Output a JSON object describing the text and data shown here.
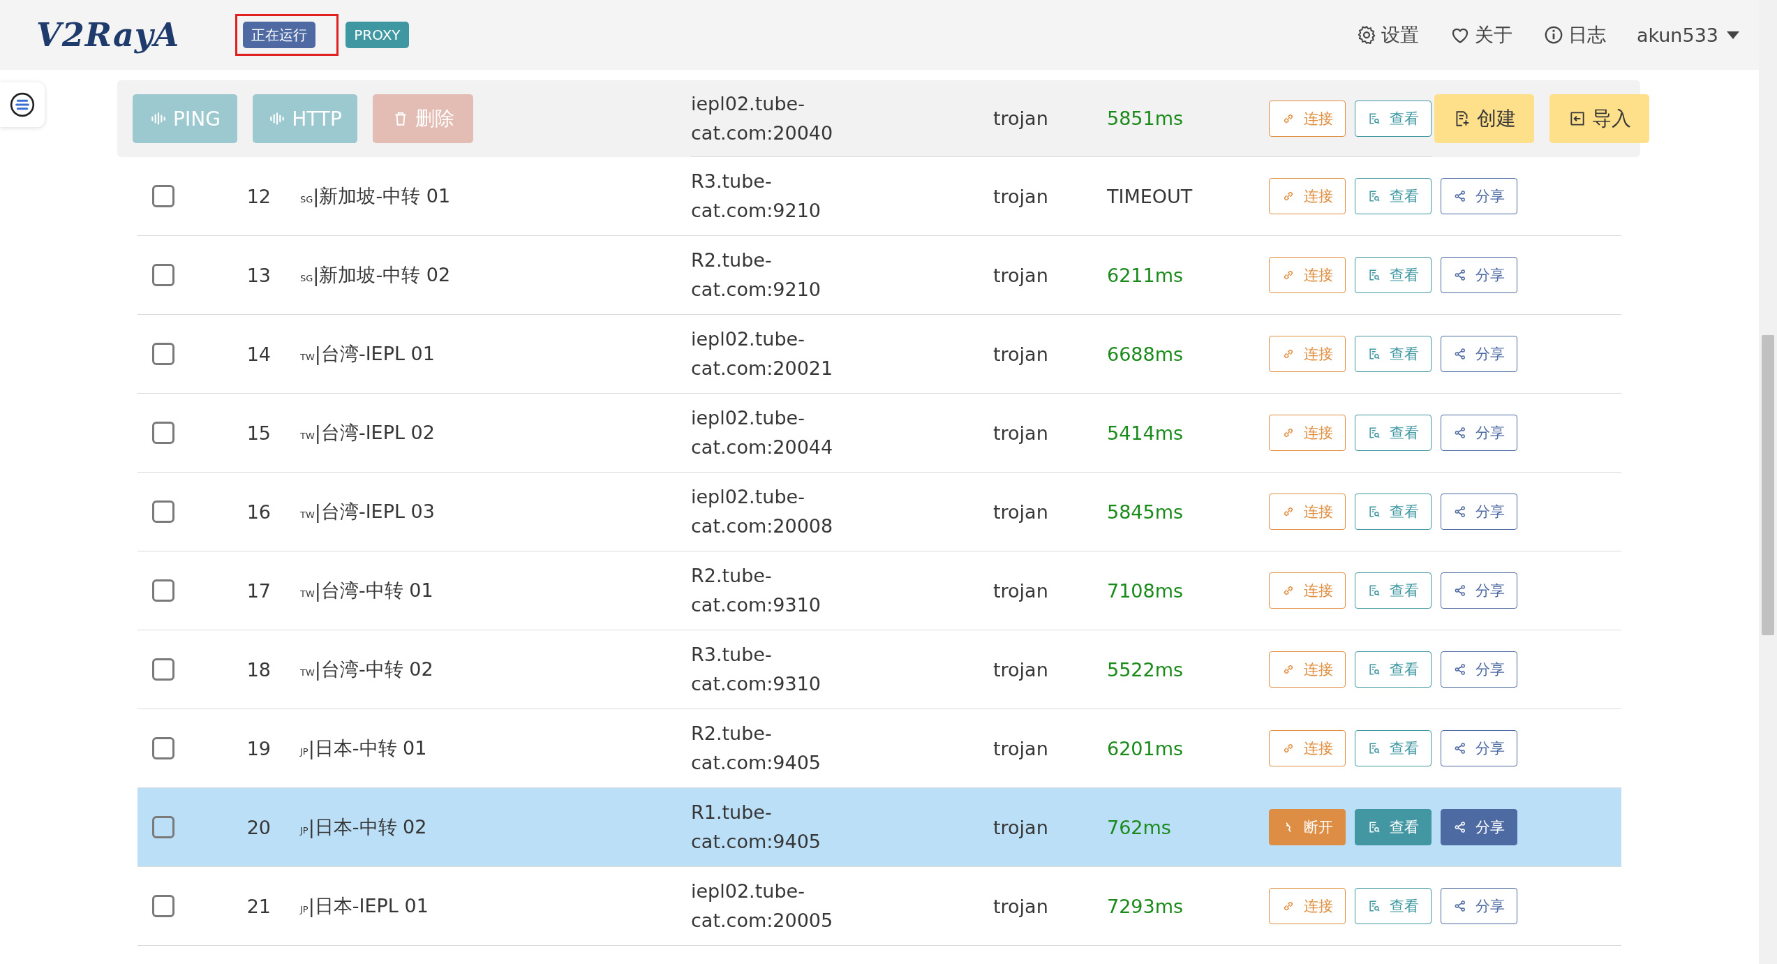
{
  "header": {
    "logo": "V2RayA",
    "status_badge": "正在运行",
    "status_highlighted": true,
    "mode_badge": "PROXY",
    "nav": [
      {
        "kind": "settings",
        "label": "设置"
      },
      {
        "kind": "about",
        "label": "关于"
      },
      {
        "kind": "log",
        "label": "日志"
      },
      {
        "kind": "user",
        "label": "akun533"
      }
    ]
  },
  "toolbar": {
    "left": [
      {
        "kind": "ping",
        "label": "PING"
      },
      {
        "kind": "http",
        "label": "HTTP"
      },
      {
        "kind": "delete",
        "label": "删除"
      }
    ],
    "right": [
      {
        "kind": "create",
        "label": "创建"
      },
      {
        "kind": "import",
        "label": "导入"
      }
    ]
  },
  "rows": [
    {
      "selected": false,
      "address": [
        "iepl02.tube-",
        "cat.com:20040"
      ],
      "protocol": "trojan",
      "latency": "5851ms",
      "timed_out": false,
      "actions": [
        {
          "kind": "connect",
          "label": "连接"
        },
        {
          "kind": "view",
          "label": "查看"
        }
      ]
    },
    {
      "checked": false,
      "selected": false,
      "number": "12",
      "region": "sg",
      "name": "|新加坡-中转 01",
      "address": [
        "R3.tube-",
        "cat.com:9210"
      ],
      "protocol": "trojan",
      "latency": "TIMEOUT",
      "timed_out": true,
      "actions": [
        {
          "kind": "connect",
          "label": "连接"
        },
        {
          "kind": "view",
          "label": "查看"
        },
        {
          "kind": "share",
          "label": "分享"
        }
      ]
    },
    {
      "checked": false,
      "selected": false,
      "number": "13",
      "region": "sg",
      "name": "|新加坡-中转 02",
      "address": [
        "R2.tube-",
        "cat.com:9210"
      ],
      "protocol": "trojan",
      "latency": "6211ms",
      "timed_out": false,
      "actions": [
        {
          "kind": "connect",
          "label": "连接"
        },
        {
          "kind": "view",
          "label": "查看"
        },
        {
          "kind": "share",
          "label": "分享"
        }
      ]
    },
    {
      "checked": false,
      "selected": false,
      "number": "14",
      "region": "tw",
      "name": "|台湾-IEPL 01",
      "address": [
        "iepl02.tube-",
        "cat.com:20021"
      ],
      "protocol": "trojan",
      "latency": "6688ms",
      "timed_out": false,
      "actions": [
        {
          "kind": "connect",
          "label": "连接"
        },
        {
          "kind": "view",
          "label": "查看"
        },
        {
          "kind": "share",
          "label": "分享"
        }
      ]
    },
    {
      "checked": false,
      "selected": false,
      "number": "15",
      "region": "tw",
      "name": "|台湾-IEPL 02",
      "address": [
        "iepl02.tube-",
        "cat.com:20044"
      ],
      "protocol": "trojan",
      "latency": "5414ms",
      "timed_out": false,
      "actions": [
        {
          "kind": "connect",
          "label": "连接"
        },
        {
          "kind": "view",
          "label": "查看"
        },
        {
          "kind": "share",
          "label": "分享"
        }
      ]
    },
    {
      "checked": false,
      "selected": false,
      "number": "16",
      "region": "tw",
      "name": "|台湾-IEPL 03",
      "address": [
        "iepl02.tube-",
        "cat.com:20008"
      ],
      "protocol": "trojan",
      "latency": "5845ms",
      "timed_out": false,
      "actions": [
        {
          "kind": "connect",
          "label": "连接"
        },
        {
          "kind": "view",
          "label": "查看"
        },
        {
          "kind": "share",
          "label": "分享"
        }
      ]
    },
    {
      "checked": false,
      "selected": false,
      "number": "17",
      "region": "tw",
      "name": "|台湾-中转 01",
      "address": [
        "R2.tube-",
        "cat.com:9310"
      ],
      "protocol": "trojan",
      "latency": "7108ms",
      "timed_out": false,
      "actions": [
        {
          "kind": "connect",
          "label": "连接"
        },
        {
          "kind": "view",
          "label": "查看"
        },
        {
          "kind": "share",
          "label": "分享"
        }
      ]
    },
    {
      "checked": false,
      "selected": false,
      "number": "18",
      "region": "tw",
      "name": "|台湾-中转 02",
      "address": [
        "R3.tube-",
        "cat.com:9310"
      ],
      "protocol": "trojan",
      "latency": "5522ms",
      "timed_out": false,
      "actions": [
        {
          "kind": "connect",
          "label": "连接"
        },
        {
          "kind": "view",
          "label": "查看"
        },
        {
          "kind": "share",
          "label": "分享"
        }
      ]
    },
    {
      "checked": false,
      "selected": false,
      "number": "19",
      "region": "jp",
      "name": "|日本-中转 01",
      "address": [
        "R2.tube-",
        "cat.com:9405"
      ],
      "protocol": "trojan",
      "latency": "6201ms",
      "timed_out": false,
      "actions": [
        {
          "kind": "connect",
          "label": "连接"
        },
        {
          "kind": "view",
          "label": "查看"
        },
        {
          "kind": "share",
          "label": "分享"
        }
      ]
    },
    {
      "checked": false,
      "selected": true,
      "number": "20",
      "region": "jp",
      "name": "|日本-中转 02",
      "address": [
        "R1.tube-",
        "cat.com:9405"
      ],
      "protocol": "trojan",
      "latency": "762ms",
      "timed_out": false,
      "actions": [
        {
          "kind": "disconnect",
          "label": "断开"
        },
        {
          "kind": "view",
          "label": "查看"
        },
        {
          "kind": "share",
          "label": "分享"
        }
      ]
    },
    {
      "checked": false,
      "selected": false,
      "number": "21",
      "region": "jp",
      "name": "|日本-IEPL 01",
      "address": [
        "iepl02.tube-",
        "cat.com:20005"
      ],
      "protocol": "trojan",
      "latency": "7293ms",
      "timed_out": false,
      "actions": [
        {
          "kind": "connect",
          "label": "连接"
        },
        {
          "kind": "view",
          "label": "查看"
        },
        {
          "kind": "share",
          "label": "分享"
        }
      ]
    }
  ]
}
